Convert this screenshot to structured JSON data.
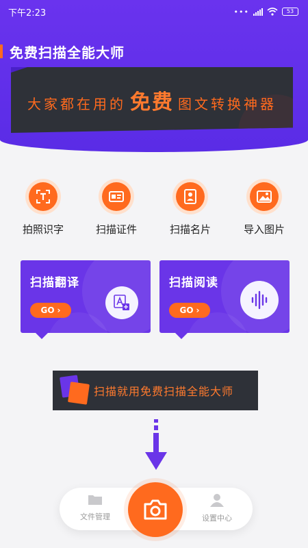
{
  "status_bar": {
    "time": "下午2:23",
    "battery": "53"
  },
  "header": {
    "title": "免费扫描全能大师",
    "banner": {
      "prefix": "大家都在用的",
      "highlight": "免费",
      "suffix": "图文转换神器"
    }
  },
  "actions": [
    {
      "label": "拍照识字",
      "icon": "text-recognition-icon"
    },
    {
      "label": "扫描证件",
      "icon": "id-card-icon"
    },
    {
      "label": "扫描名片",
      "icon": "business-card-icon"
    },
    {
      "label": "导入图片",
      "icon": "image-icon"
    }
  ],
  "cards": [
    {
      "title": "扫描翻译",
      "go": "GO",
      "icon": "translate-icon"
    },
    {
      "title": "扫描阅读",
      "go": "GO",
      "icon": "sound-wave-icon"
    }
  ],
  "promo": {
    "text": "扫描就用免费扫描全能大师"
  },
  "bottom_nav": {
    "left": {
      "label": "文件管理",
      "icon": "folder-icon"
    },
    "center": {
      "icon": "camera-icon"
    },
    "right": {
      "label": "设置中心",
      "icon": "user-icon"
    }
  },
  "colors": {
    "primary": "#6a33ee",
    "accent": "#ff6a1e",
    "dark": "#2e3138"
  }
}
